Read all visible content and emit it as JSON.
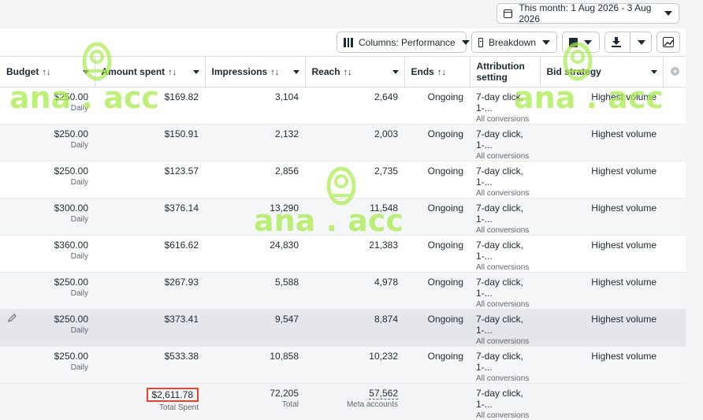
{
  "date_range": {
    "label": "This month: 1 Aug 2026 - 3 Aug 2026"
  },
  "toolbar": {
    "columns_label": "Columns: Performance",
    "breakdown_label": "Breakdown",
    "reports_icon": "report-icon",
    "export_icon": "download-icon",
    "chart_icon": "chart-icon"
  },
  "headers": {
    "budget": "Budget",
    "amount_spent": "Amount spent",
    "impressions": "Impressions",
    "reach": "Reach",
    "ends": "Ends",
    "attribution_line1": "Attribution",
    "attribution_line2": "setting",
    "bid_strategy": "Bid strategy",
    "sort_glyph": "↑↓"
  },
  "rows": [
    {
      "budget": "$250.00",
      "budget_type": "Daily",
      "spent": "$169.82",
      "impressions": "3,104",
      "reach": "2,649",
      "ends": "Ongoing",
      "attribution": "7-day click, 1-...",
      "attribution_sub": "All conversions",
      "bid": "Highest volume"
    },
    {
      "budget": "$250.00",
      "budget_type": "Daily",
      "spent": "$150.91",
      "impressions": "2,132",
      "reach": "2,003",
      "ends": "Ongoing",
      "attribution": "7-day click, 1-...",
      "attribution_sub": "All conversions",
      "bid": "Highest volume"
    },
    {
      "budget": "$250.00",
      "budget_type": "Daily",
      "spent": "$123.57",
      "impressions": "2,856",
      "reach": "2,735",
      "ends": "Ongoing",
      "attribution": "7-day click, 1-...",
      "attribution_sub": "All conversions",
      "bid": "Highest volume"
    },
    {
      "budget": "$300.00",
      "budget_type": "Daily",
      "spent": "$376.14",
      "impressions": "13,290",
      "reach": "11,548",
      "ends": "Ongoing",
      "attribution": "7-day click, 1-...",
      "attribution_sub": "All conversions",
      "bid": "Highest volume"
    },
    {
      "budget": "$360.00",
      "budget_type": "Daily",
      "spent": "$616.62",
      "impressions": "24,830",
      "reach": "21,383",
      "ends": "Ongoing",
      "attribution": "7-day click, 1-...",
      "attribution_sub": "All conversions",
      "bid": "Highest volume"
    },
    {
      "budget": "$250.00",
      "budget_type": "Daily",
      "spent": "$267.93",
      "impressions": "5,588",
      "reach": "4,978",
      "ends": "Ongoing",
      "attribution": "7-day click, 1-...",
      "attribution_sub": "All conversions",
      "bid": "Highest volume"
    },
    {
      "budget": "$250.00",
      "budget_type": "Daily",
      "spent": "$373.41",
      "impressions": "9,547",
      "reach": "8,874",
      "ends": "Ongoing",
      "attribution": "7-day click, 1-...",
      "attribution_sub": "All conversions",
      "bid": "Highest volume"
    },
    {
      "budget": "$250.00",
      "budget_type": "Daily",
      "spent": "$533.38",
      "impressions": "10,858",
      "reach": "10,232",
      "ends": "Ongoing",
      "attribution": "7-day click, 1-...",
      "attribution_sub": "All conversions",
      "bid": "Highest volume"
    }
  ],
  "totals": {
    "spent": "$2,611.78",
    "spent_label": "Total Spent",
    "impressions": "72,205",
    "impressions_label": "Total",
    "reach": "57,562",
    "reach_label": "Meta accounts",
    "attribution": "7-day click, 1-...",
    "attribution_sub": "All conversions"
  },
  "watermark": {
    "text": "ana . acc"
  },
  "colors": {
    "highlight_border": "#e8452c",
    "watermark": "#a8ec4a"
  }
}
